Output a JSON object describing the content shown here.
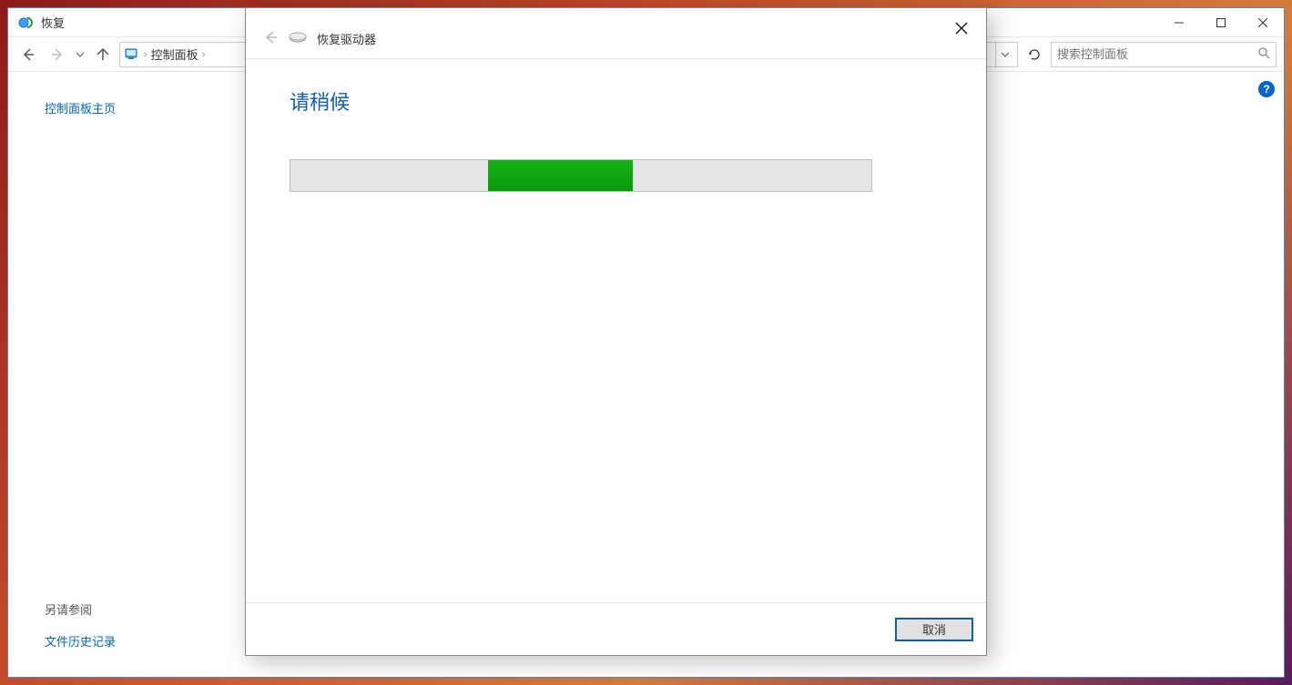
{
  "window": {
    "title": "恢复"
  },
  "navbar": {
    "breadcrumb_root": "控制面板"
  },
  "search": {
    "placeholder": "搜索控制面板"
  },
  "sidebar": {
    "home_link": "控制面板主页",
    "see_also_label": "另请参阅",
    "file_history_link": "文件历史记录"
  },
  "dialog": {
    "title": "恢复驱动器",
    "wait_message": "请稍候",
    "cancel_label": "取消",
    "progress": {
      "chunk_left_pct": 34,
      "chunk_width_pct": 25
    }
  }
}
